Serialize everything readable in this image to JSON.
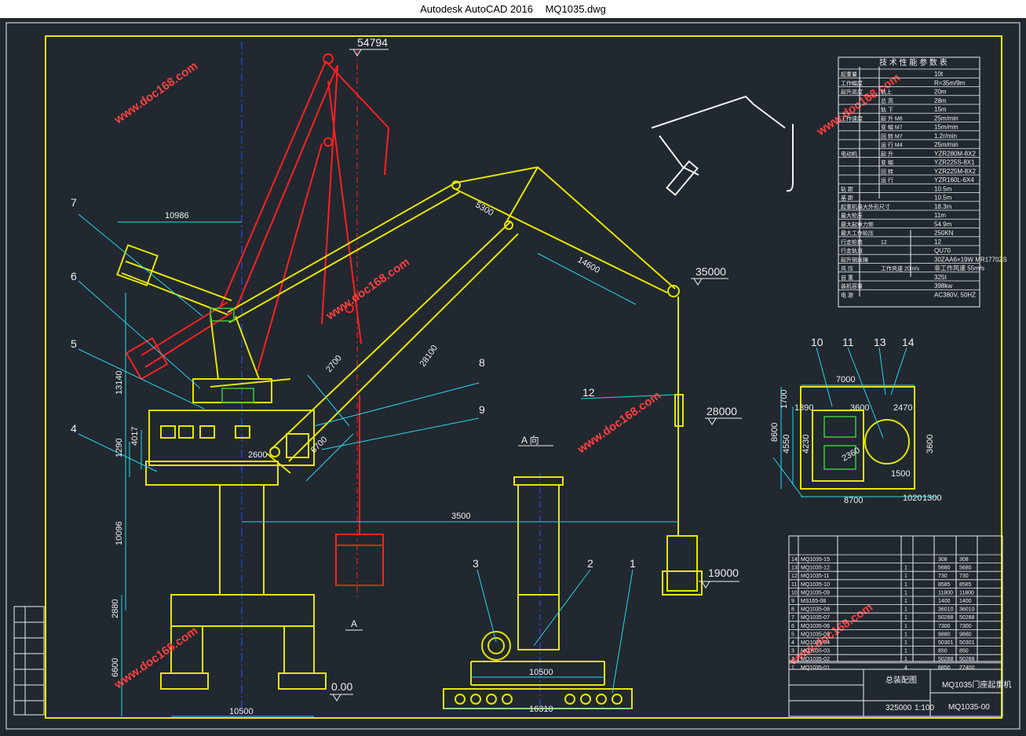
{
  "window": {
    "app": "Autodesk AutoCAD 2016",
    "file": "MQ1035.dwg"
  },
  "colors": {
    "background": "#212830",
    "frame": "#e8e800",
    "yellow": "#e6e600",
    "red": "#ff2020",
    "cyan": "#27d7e8",
    "white": "#f0f0f0",
    "green": "#3cc83c",
    "blue": "#3050ff",
    "watermark": "#ff4040"
  },
  "watermark": "www.doc168.com",
  "elevations": {
    "top": "54794",
    "boom_tip": "35000",
    "hook": "28000",
    "bucket": "19000",
    "ground": "0.00"
  },
  "dimensions": {
    "main_width": "10500",
    "boom_radius": "35000_radius",
    "radius_label": "3500",
    "overhang": "10986",
    "boom_upper": "5300",
    "boom_mid": "14600",
    "boom_lower": "28100",
    "arm": "2700",
    "pivot": "2600",
    "base_arm": "6700",
    "h_1": "13140",
    "h_2": "4017",
    "h_3": "1290",
    "h_4": "10096",
    "h_5": "2880",
    "h_6": "6600",
    "side_width": "10500",
    "side_total": "16310",
    "plan_top": "7000",
    "plan_bottom": "8700",
    "plan_h": "8600",
    "plan_h2": "4550",
    "plan_h3": "4230",
    "plan_a": "1700",
    "plan_b": "1390",
    "plan_c": "3600",
    "plan_d": "1500",
    "plan_e": "2470",
    "plan_f": "3600",
    "plan_g": "1300",
    "plan_h4": "1020",
    "plan_r": "2360"
  },
  "part_labels": [
    "1",
    "2",
    "3",
    "4",
    "5",
    "6",
    "7",
    "8",
    "9",
    "10",
    "11",
    "12",
    "13",
    "14"
  ],
  "view_labels": {
    "section": "A  向",
    "arrow": "A"
  },
  "spec_table": {
    "title": "技 术 性 能 参 数 表",
    "rows": [
      [
        "起重量",
        "",
        "10t"
      ],
      [
        "工作幅度",
        "",
        "R=35m/9m"
      ],
      [
        "起升高度",
        "轨上",
        "20m"
      ],
      [
        "",
        "总 高",
        "28m"
      ],
      [
        "",
        "轨 下",
        "15m"
      ],
      [
        "工作速度",
        "起 升 M8",
        "25m/min"
      ],
      [
        "",
        "变 幅 M7",
        "15m/min"
      ],
      [
        "",
        "回 转 M7",
        "1.2r/min"
      ],
      [
        "",
        "运 行 M4",
        "25m/min"
      ],
      [
        "电动机",
        "起 升",
        "YZR280M-8X2"
      ],
      [
        "",
        "变 幅",
        "YZR225S-8X1"
      ],
      [
        "",
        "回 转",
        "YZR225M-8X2"
      ],
      [
        "",
        "运 行",
        "YZR160L-6X4"
      ],
      [
        "轨 距",
        "",
        "10.5m"
      ],
      [
        "基 距",
        "",
        "10.5m"
      ],
      [
        "起重机最大外形尺寸",
        "",
        "18.3m"
      ],
      [
        "最大轮压",
        "",
        "11m"
      ],
      [
        "最大起重力矩",
        "",
        "54.9m"
      ],
      [
        "最大工作轮压",
        "",
        "250KN"
      ],
      [
        "行走轮数",
        "12",
        "12"
      ],
      [
        "行走轨道",
        "",
        "QU70"
      ],
      [
        "起升钢丝绳",
        "",
        "30ZAA6×19W MR1770ZS"
      ],
      [
        "风 压",
        "工作风速 20m/s",
        "非工作风速 55m/s"
      ],
      [
        "自 重",
        "",
        "325t"
      ],
      [
        "装机容量",
        "",
        "398kw"
      ],
      [
        "电 源",
        "",
        "AC380V, 50HZ"
      ]
    ]
  },
  "parts_table": {
    "rows": [
      [
        "14",
        "MQ1035-15",
        "",
        "",
        "308",
        "308"
      ],
      [
        "13",
        "MQ1035-12",
        "",
        "1",
        "5680",
        "5680"
      ],
      [
        "12",
        "MQ1035-11",
        "",
        "1",
        "730",
        "730"
      ],
      [
        "11",
        "MQ1035-10",
        "",
        "1",
        "8585",
        "8585"
      ],
      [
        "10",
        "MQ1035-09",
        "",
        "1",
        "11800",
        "11800"
      ],
      [
        "9",
        "MS165-08",
        "",
        "1",
        "1400",
        "1400"
      ],
      [
        "8",
        "MQ1035-08",
        "",
        "1",
        "36010",
        "36010"
      ],
      [
        "7",
        "MQ1035-07",
        "",
        "1",
        "50288",
        "50288"
      ],
      [
        "6",
        "MQ1035-06",
        "",
        "1",
        "7300",
        "7300"
      ],
      [
        "5",
        "MQ1035-05",
        "",
        "1",
        "9880",
        "9880"
      ],
      [
        "4",
        "MQ1035-04",
        "",
        "1",
        "50301",
        "50301"
      ],
      [
        "3",
        "MQ1035-03",
        "",
        "1",
        "850",
        "850"
      ],
      [
        "2",
        "MQ1035-02",
        "",
        "1",
        "50288",
        "50288"
      ],
      [
        "1",
        "MQ1035-01",
        "",
        "4",
        "6850",
        "27400"
      ]
    ]
  },
  "title_block": {
    "drawing_title": "MQ1035门座起重机",
    "drawing_no": "MQ1035-00",
    "assembly": "总装配图",
    "weight": "325000",
    "scale": "1:100"
  }
}
